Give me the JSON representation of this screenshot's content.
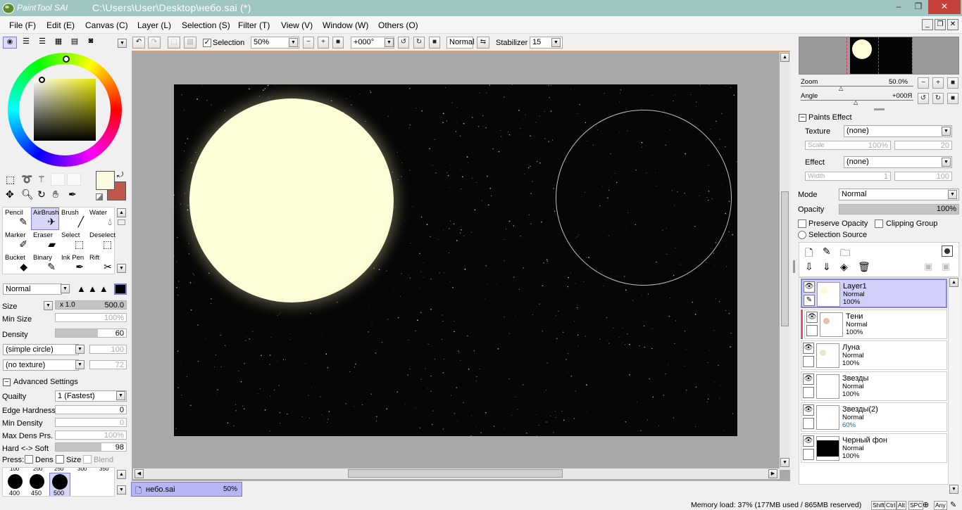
{
  "window": {
    "app_name": "PaintTool SAI",
    "title": "C:\\Users\\User\\Desktop\\небо.sai (*)",
    "minimize_glyph": "–",
    "restore_glyph": "❐",
    "close_glyph": "✕"
  },
  "menu": [
    "File (F)",
    "Edit (E)",
    "Canvas (C)",
    "Layer (L)",
    "Selection (S)",
    "Filter (T)",
    "View (V)",
    "Window (W)",
    "Others (O)"
  ],
  "toolbar": {
    "selection_label": "Selection",
    "zoom": "50%",
    "angle": "+000°",
    "mode": "Normal",
    "stabilizer_label": "Stabilizer",
    "stabilizer": "15"
  },
  "tools": [
    {
      "label": "Pencil",
      "icon": "pencil-icon"
    },
    {
      "label": "AirBrush",
      "icon": "airbrush-icon",
      "selected": true
    },
    {
      "label": "Brush",
      "icon": "brush-icon"
    },
    {
      "label": "Water",
      "icon": "water-icon"
    },
    {
      "label": "Marker",
      "icon": "marker-icon"
    },
    {
      "label": "Eraser",
      "icon": "eraser-icon"
    },
    {
      "label": "Select",
      "icon": "select-brush-icon"
    },
    {
      "label": "Deselect",
      "icon": "deselect-brush-icon"
    },
    {
      "label": "Bucket",
      "icon": "bucket-icon"
    },
    {
      "label": "Binary",
      "icon": "binary-icon"
    },
    {
      "label": "Ink Pen",
      "icon": "ink-pen-icon"
    },
    {
      "label": "Rift",
      "icon": "rift-icon"
    }
  ],
  "brush": {
    "blend_mode": "Normal",
    "size_label": "Size",
    "size_mult": "x 1.0",
    "size": "500.0",
    "min_size_label": "Min Size",
    "min_size": "100%",
    "density_label": "Density",
    "density": "60",
    "density_fill": 0.6,
    "shape": "(simple circle)",
    "shape_val": "100",
    "texture": "(no texture)",
    "texture_val": "72",
    "advanced_label": "Advanced Settings",
    "quality_label": "Quailty",
    "quality": "1 (Fastest)",
    "edge_hardness_label": "Edge Hardness",
    "edge_hardness": "0",
    "min_density_label": "Min Density",
    "min_density": "0",
    "max_dens_label": "Max Dens Prs.",
    "max_dens": "100%",
    "hard_soft_label": "Hard <-> Soft",
    "hard_soft": "98",
    "hard_soft_fill": 0.65,
    "press_label": "Press:",
    "press_dens": "Dens",
    "press_size": "Size",
    "press_blend": "Blend"
  },
  "brush_sizes": {
    "top_row": [
      "100",
      "200",
      "250",
      "300",
      "350"
    ],
    "presets": [
      "400",
      "450",
      "500"
    ]
  },
  "colors": {
    "primary": "#fbfbe3",
    "secondary": "#c0574a",
    "canvas_bg": "#060606",
    "moon": "#fdfdd8",
    "accent_selected": "#8787d8",
    "tab_bg": "#b6b6f4"
  },
  "document_tab": {
    "name": "небо.sai",
    "zoom": "50%"
  },
  "navigator": {
    "zoom_label": "Zoom",
    "zoom": "50.0%",
    "angle_label": "Angle",
    "angle": "+000Я"
  },
  "paints_effect": {
    "header": "Paints Effect",
    "texture_label": "Texture",
    "texture": "(none)",
    "scale_label": "Scale",
    "scale": "100%",
    "scale_val": "20",
    "effect_label": "Effect",
    "effect": "(none)",
    "width_label": "Width",
    "width": "1",
    "width_val": "100"
  },
  "layer_props": {
    "mode_label": "Mode",
    "mode": "Normal",
    "opacity_label": "Opacity",
    "opacity": "100%",
    "preserve_opacity": "Preserve Opacity",
    "clipping_group": "Clipping Group",
    "selection_source": "Selection Source"
  },
  "layers": [
    {
      "name": "Layer1",
      "mode": "Normal",
      "opacity": "100%",
      "selected": true
    },
    {
      "name": "Тени",
      "mode": "Normal",
      "opacity": "100%",
      "clipped": true
    },
    {
      "name": "Луна",
      "mode": "Normal",
      "opacity": "100%"
    },
    {
      "name": "Звезды",
      "mode": "Normal",
      "opacity": "100%"
    },
    {
      "name": "Звезды(2)",
      "mode": "Normal",
      "opacity": "60%"
    },
    {
      "name": "Черный фон",
      "mode": "Normal",
      "opacity": "100%"
    }
  ],
  "status": {
    "memory": "Memory load: 37% (177MB used / 865MB reserved)",
    "keys": [
      "Shift",
      "Ctrl",
      "Alt",
      "SPC",
      "Any"
    ]
  }
}
